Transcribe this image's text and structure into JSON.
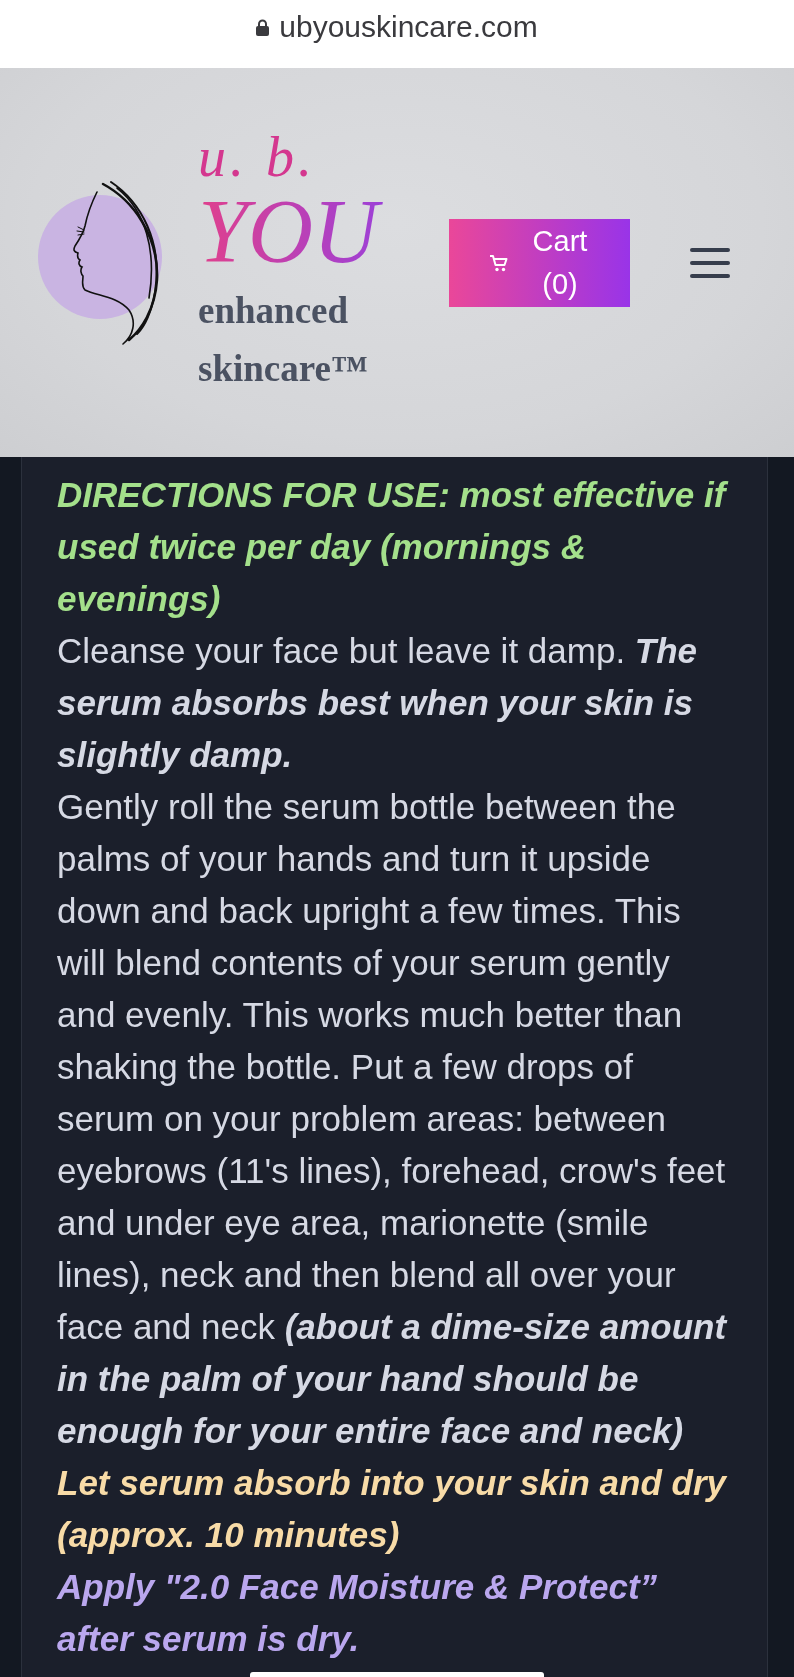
{
  "browser": {
    "url": "ubyouskincare.com"
  },
  "header": {
    "brand": {
      "initials": "u. b.",
      "name": "YOU",
      "tagline": "enhanced skincare™"
    },
    "cart_button": {
      "label": "Cart (0)"
    }
  },
  "directions": [
    {
      "kind": "emphasis",
      "color": "#a4e08b",
      "text": "DIRECTIONS FOR USE: most effective if used twice per day (mornings & evenings)"
    },
    {
      "kind": "body",
      "color": "#d6d9e4",
      "text": "Cleanse your face but leave it damp. **The serum absorbs best when your skin is slightly damp.**"
    },
    {
      "kind": "body",
      "color": "#d6d9e4",
      "text": "Gently roll the serum bottle between the palms of your hands and turn it upside down and back upright a few times. This will blend contents of your serum gently and evenly. This works much better than shaking the bottle. Put a few drops of serum on your problem areas: between eyebrows (11's lines), forehead, crow's feet and under eye area, marionette (smile lines), neck and then blend all over your face and neck **(about a dime-size amount in the palm of your hand should be enough for your entire face and neck)**"
    },
    {
      "kind": "emphasis",
      "color": "#f8dba7",
      "text": "Let serum absorb into your skin and dry (approx. 10 minutes)"
    },
    {
      "kind": "emphasis",
      "color": "#baa7ee",
      "text": "Apply \"2.0 Face Moisture & Protect” after serum is dry."
    }
  ]
}
